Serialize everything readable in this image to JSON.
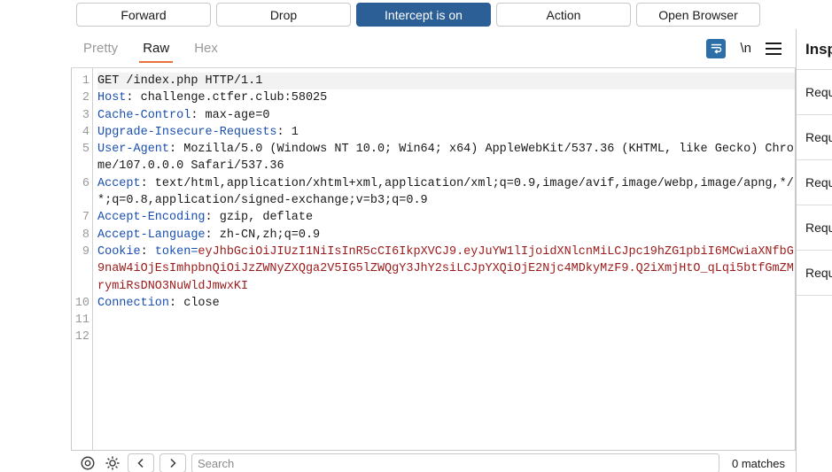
{
  "action_bar": {
    "buttons": [
      {
        "label": "Forward",
        "name": "forward-button",
        "active": false
      },
      {
        "label": "Drop",
        "name": "drop-button",
        "active": false
      },
      {
        "label": "Intercept is on",
        "name": "intercept-toggle-button",
        "active": true
      },
      {
        "label": "Action",
        "name": "action-button",
        "active": false
      },
      {
        "label": "Open Browser",
        "name": "open-browser-button",
        "active": false
      }
    ],
    "accent_color": "#2c5f96"
  },
  "tabs": {
    "items": [
      {
        "label": "Pretty",
        "active": false
      },
      {
        "label": "Raw",
        "active": true
      },
      {
        "label": "Hex",
        "active": false
      }
    ],
    "underline_color": "#e8703a",
    "icons": {
      "wrap": "word-wrap-icon",
      "newline": "\\n",
      "menu": "hamburger-menu-icon"
    }
  },
  "editor": {
    "line_numbers": [
      "1",
      "2",
      "3",
      "4",
      "5",
      "",
      "6",
      "",
      "",
      "7",
      "8",
      "9",
      "",
      "",
      "",
      "10",
      "11",
      "12"
    ],
    "lines": [
      {
        "n": "1",
        "first": true,
        "parts": [
          {
            "t": "GET /index.php HTTP/1.1",
            "c": "req"
          }
        ]
      },
      {
        "n": "2",
        "parts": [
          {
            "t": "Host",
            "c": "hk"
          },
          {
            "t": ": challenge.ctfer.club:58025",
            "c": "hv"
          }
        ]
      },
      {
        "n": "3",
        "parts": [
          {
            "t": "Cache-Control",
            "c": "hk"
          },
          {
            "t": ": max-age=0",
            "c": "hv"
          }
        ]
      },
      {
        "n": "4",
        "parts": [
          {
            "t": "Upgrade-Insecure-Requests",
            "c": "hk"
          },
          {
            "t": ": 1",
            "c": "hv"
          }
        ]
      },
      {
        "n": "5",
        "parts": [
          {
            "t": "User-Agent",
            "c": "hk"
          },
          {
            "t": ": Mozilla/5.0 (Windows NT 10.0; Win64; x64) AppleWebKit/537.36 (KHTML, like Gecko) Chrome/107.0.0.0 Safari/537.36",
            "c": "hv"
          }
        ]
      },
      {
        "n": "6",
        "parts": [
          {
            "t": "Accept",
            "c": "hk"
          },
          {
            "t": ": text/html,application/xhtml+xml,application/xml;q=0.9,image/avif,image/webp,image/apng,*/*;q=0.8,application/signed-exchange;v=b3;q=0.9",
            "c": "hv"
          }
        ]
      },
      {
        "n": "7",
        "parts": [
          {
            "t": "Accept-Encoding",
            "c": "hk"
          },
          {
            "t": ": gzip, deflate",
            "c": "hv"
          }
        ]
      },
      {
        "n": "8",
        "parts": [
          {
            "t": "Accept-Language",
            "c": "hk"
          },
          {
            "t": ": zh-CN,zh;q=0.9",
            "c": "hv"
          }
        ]
      },
      {
        "n": "9",
        "parts": [
          {
            "t": "Cookie",
            "c": "hk"
          },
          {
            "t": ": ",
            "c": "hv"
          },
          {
            "t": "token=",
            "c": "hk"
          },
          {
            "t": "eyJhbGciOiJIUzI1NiIsInR5cCI6IkpXVCJ9.eyJuYW1lIjoidXNlcnMiLCJpc19hZG1pbiI6MCwiaXNfbG9naW4iOjEsImhpbnQiOiJzZWNyZXQga2V5IG5lZWQgY3JhY2siLCJpYXQiOjE2Njc4MDkyMzF9.Q2iXmjHtO_qLqi5btfGmZMrymiRsDNO3NuWldJmwxKI",
            "c": "tok"
          }
        ]
      },
      {
        "n": "10",
        "parts": [
          {
            "t": "Connection",
            "c": "hk"
          },
          {
            "t": ": close",
            "c": "hv"
          }
        ]
      },
      {
        "n": "11",
        "parts": [
          {
            "t": "",
            "c": "hv"
          }
        ]
      },
      {
        "n": "12",
        "parts": [
          {
            "t": "",
            "c": "hv"
          }
        ]
      }
    ],
    "colors": {
      "header_key": "#1a4fb0",
      "token_value": "#9c1b1b",
      "line_number": "#9a9a9a"
    }
  },
  "search_bar": {
    "placeholder": "Search",
    "value": "",
    "matches_label": "0 matches",
    "icons": {
      "target": "target-icon",
      "settings": "gear-icon",
      "prev": "chevron-left-icon",
      "next": "chevron-right-icon"
    }
  },
  "inspector": {
    "title": "Inspector",
    "rows": [
      {
        "label": "Request attributes"
      },
      {
        "label": "Request query parameters"
      },
      {
        "label": "Request body parameters"
      },
      {
        "label": "Request cookies"
      },
      {
        "label": "Request headers"
      }
    ]
  }
}
